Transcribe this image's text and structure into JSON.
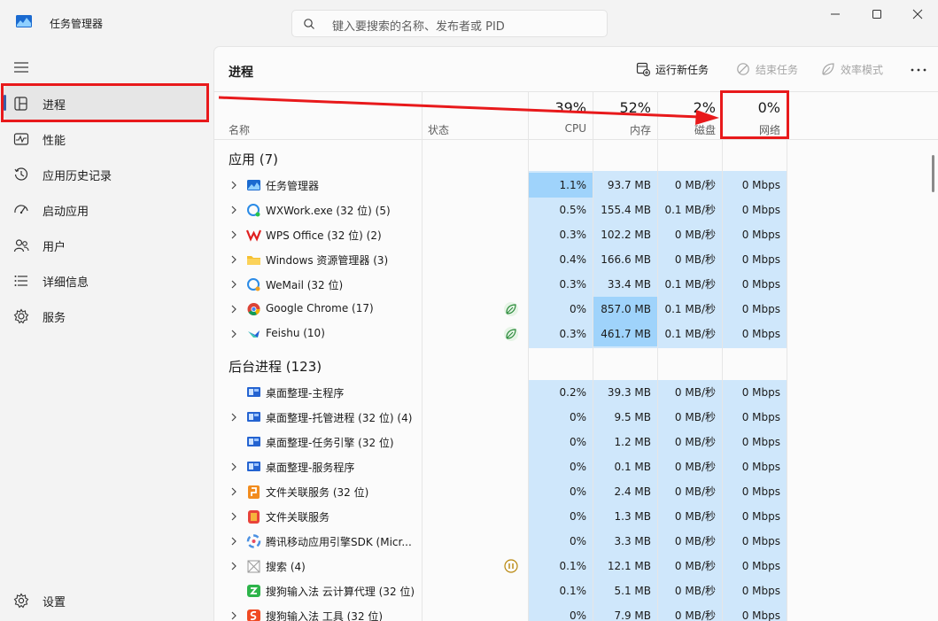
{
  "app": {
    "title": "任务管理器"
  },
  "search": {
    "placeholder": "键入要搜索的名称、发布者或 PID"
  },
  "sidebar": {
    "items": [
      {
        "label": "进程",
        "icon": "processes-icon"
      },
      {
        "label": "性能",
        "icon": "performance-icon"
      },
      {
        "label": "应用历史记录",
        "icon": "history-icon"
      },
      {
        "label": "启动应用",
        "icon": "startup-icon"
      },
      {
        "label": "用户",
        "icon": "users-icon"
      },
      {
        "label": "详细信息",
        "icon": "details-icon"
      },
      {
        "label": "服务",
        "icon": "services-icon"
      }
    ],
    "settings": "设置"
  },
  "main": {
    "title": "进程",
    "toolbar": {
      "run_new": "运行新任务",
      "end_task": "结束任务",
      "efficiency": "效率模式"
    }
  },
  "columns": {
    "name": "名称",
    "status": "状态",
    "cpu": {
      "pct": "39%",
      "label": "CPU"
    },
    "memory": {
      "pct": "52%",
      "label": "内存"
    },
    "disk": {
      "pct": "2%",
      "label": "磁盘"
    },
    "network": {
      "pct": "0%",
      "label": "网络"
    }
  },
  "groups": {
    "apps": "应用 (7)",
    "background": "后台进程 (123)"
  },
  "apps": [
    {
      "name": "任务管理器",
      "cpu": "1.1%",
      "mem": "93.7 MB",
      "disk": "0 MB/秒",
      "net": "0 Mbps"
    },
    {
      "name": "WXWork.exe (32 位) (5)",
      "cpu": "0.5%",
      "mem": "155.4 MB",
      "disk": "0.1 MB/秒",
      "net": "0 Mbps"
    },
    {
      "name": "WPS Office (32 位) (2)",
      "cpu": "0.3%",
      "mem": "102.2 MB",
      "disk": "0 MB/秒",
      "net": "0 Mbps"
    },
    {
      "name": "Windows 资源管理器 (3)",
      "cpu": "0.4%",
      "mem": "166.6 MB",
      "disk": "0 MB/秒",
      "net": "0 Mbps"
    },
    {
      "name": "WeMail (32 位)",
      "cpu": "0.3%",
      "mem": "33.4 MB",
      "disk": "0.1 MB/秒",
      "net": "0 Mbps"
    },
    {
      "name": "Google Chrome (17)",
      "cpu": "0%",
      "mem": "857.0 MB",
      "disk": "0.1 MB/秒",
      "net": "0 Mbps"
    },
    {
      "name": "Feishu (10)",
      "cpu": "0.3%",
      "mem": "461.7 MB",
      "disk": "0.1 MB/秒",
      "net": "0 Mbps"
    }
  ],
  "background": [
    {
      "name": "桌面整理-主程序",
      "cpu": "0.2%",
      "mem": "39.3 MB",
      "disk": "0 MB/秒",
      "net": "0 Mbps"
    },
    {
      "name": "桌面整理-托管进程 (32 位) (4)",
      "cpu": "0%",
      "mem": "9.5 MB",
      "disk": "0 MB/秒",
      "net": "0 Mbps"
    },
    {
      "name": "桌面整理-任务引擎 (32 位)",
      "cpu": "0%",
      "mem": "1.2 MB",
      "disk": "0 MB/秒",
      "net": "0 Mbps"
    },
    {
      "name": "桌面整理-服务程序",
      "cpu": "0%",
      "mem": "0.1 MB",
      "disk": "0 MB/秒",
      "net": "0 Mbps"
    },
    {
      "name": "文件关联服务 (32 位)",
      "cpu": "0%",
      "mem": "2.4 MB",
      "disk": "0 MB/秒",
      "net": "0 Mbps"
    },
    {
      "name": "文件关联服务",
      "cpu": "0%",
      "mem": "1.3 MB",
      "disk": "0 MB/秒",
      "net": "0 Mbps"
    },
    {
      "name": "腾讯移动应用引擎SDK (Micr...",
      "cpu": "0%",
      "mem": "3.3 MB",
      "disk": "0 MB/秒",
      "net": "0 Mbps"
    },
    {
      "name": "搜索 (4)",
      "cpu": "0.1%",
      "mem": "12.1 MB",
      "disk": "0 MB/秒",
      "net": "0 Mbps"
    },
    {
      "name": "搜狗输入法 云计算代理 (32 位)",
      "cpu": "0.1%",
      "mem": "5.1 MB",
      "disk": "0 MB/秒",
      "net": "0 Mbps"
    },
    {
      "name": "搜狗输入法 工具 (32 位)",
      "cpu": "0%",
      "mem": "7.9 MB",
      "disk": "0 MB/秒",
      "net": "0 Mbps"
    }
  ],
  "colors": {
    "accent": "#3a5ea8",
    "highlight": "#e8191b",
    "column_bg": "#cfe7fb",
    "cell_highlight": "#9fd3fb"
  }
}
